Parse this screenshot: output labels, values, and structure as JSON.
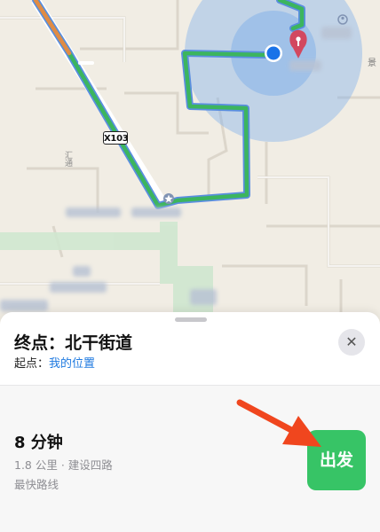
{
  "map": {
    "highway_shield": "X103",
    "road_label_vertical": "汇通",
    "poi_edge_text": "景",
    "icons": [
      "location-pin-icon",
      "current-location-icon",
      "star-icon",
      "person-icon"
    ]
  },
  "sheet": {
    "destination_prefix": "终点：",
    "destination_name": "北干街道",
    "origin_prefix": "起点：",
    "origin_value": "我的位置",
    "close_icon": "✕",
    "close_icon_name": "close-icon"
  },
  "route": {
    "duration": "8 分钟",
    "distance_and_via": "1.8 公里 · 建设四路",
    "route_type": "最快路线",
    "go_label": "出发"
  },
  "colors": {
    "route_green": "#3cb55e",
    "route_outline": "#5a8ee0",
    "go_button": "#37c466",
    "link_blue": "#1f7ae0",
    "annotation_arrow": "#f0461e",
    "accuracy_circle": "#7fb0ec"
  }
}
